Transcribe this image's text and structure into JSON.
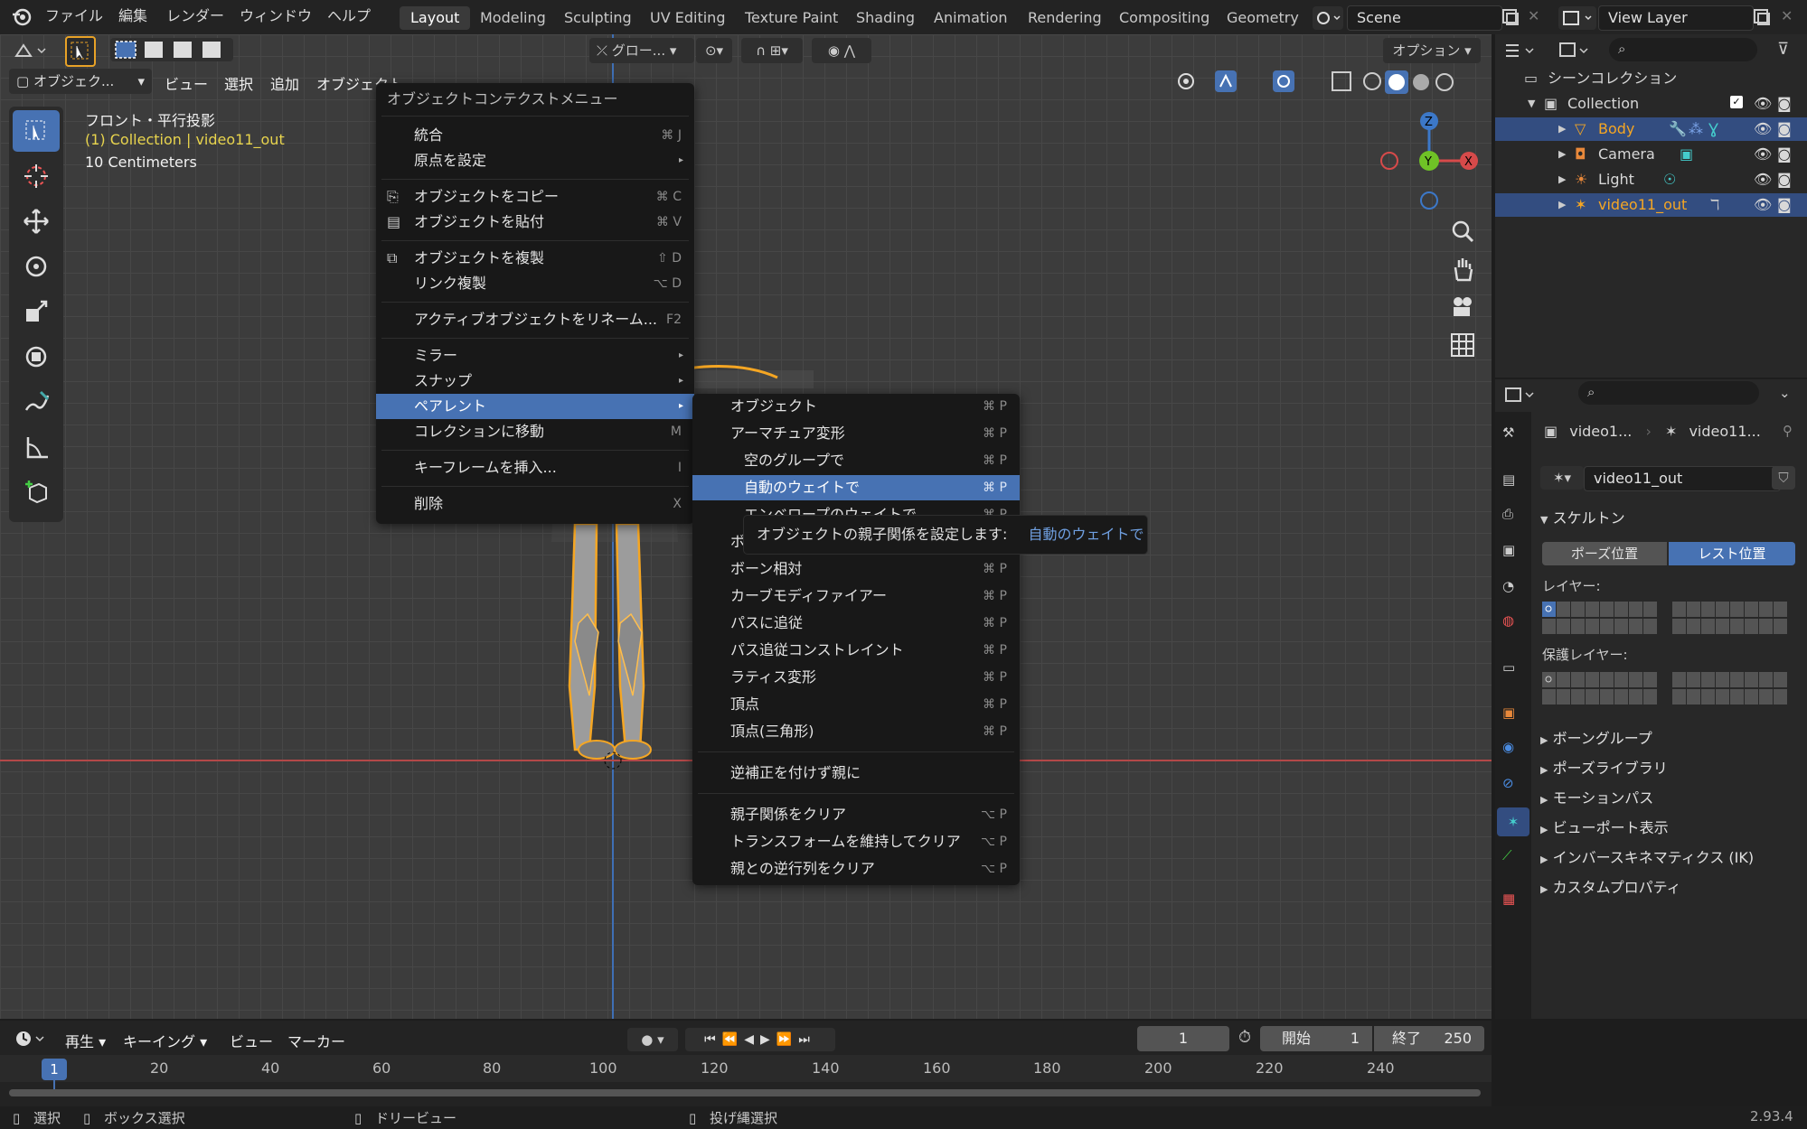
{
  "topbar": {
    "menus": [
      "ファイル",
      "編集",
      "レンダー",
      "ウィンドウ",
      "ヘルプ"
    ],
    "workspaces": [
      "Layout",
      "Modeling",
      "Sculpting",
      "UV Editing",
      "Texture Paint",
      "Shading",
      "Animation",
      "Rendering",
      "Compositing",
      "Geometry"
    ],
    "scene": "Scene",
    "view_layer": "View Layer"
  },
  "viewport": {
    "header": {
      "mode": "オブジェク...",
      "menus": [
        "ビュー",
        "選択",
        "追加",
        "オブジェクト"
      ],
      "transform": "グロー...",
      "options": "オプション"
    },
    "overlay": {
      "view_name": "フロント・平行投影",
      "collection": "(1) Collection | video11_out",
      "scale": "10 Centimeters"
    },
    "gizmo": {
      "z": "Z",
      "y": "Y",
      "x": "X"
    }
  },
  "context_menu": {
    "title": "オブジェクトコンテクストメニュー",
    "items": [
      {
        "label": "統合",
        "shortcut": "⌘ J"
      },
      {
        "label": "原点を設定",
        "shortcut": ""
      },
      {
        "label": "オブジェクトをコピー",
        "shortcut": "⌘ C"
      },
      {
        "label": "オブジェクトを貼付",
        "shortcut": "⌘ V"
      },
      {
        "label": "オブジェクトを複製",
        "shortcut": "⇧ D"
      },
      {
        "label": "リンク複製",
        "shortcut": "⌥ D"
      },
      {
        "label": "アクティブオブジェクトをリネーム...",
        "shortcut": "F2"
      },
      {
        "label": "ミラー",
        "shortcut": ""
      },
      {
        "label": "スナップ",
        "shortcut": ""
      },
      {
        "label": "ペアレント",
        "shortcut": ""
      },
      {
        "label": "コレクションに移動",
        "shortcut": "M"
      },
      {
        "label": "キーフレームを挿入...",
        "shortcut": "I"
      },
      {
        "label": "削除",
        "shortcut": "X"
      }
    ]
  },
  "parent_menu": {
    "items": [
      {
        "label": "オブジェクト",
        "shortcut": "⌘ P"
      },
      {
        "label": "アーマチュア変形",
        "shortcut": "⌘ P"
      },
      {
        "label": "空のグループで",
        "shortcut": "⌘ P"
      },
      {
        "label": "自動のウェイトで",
        "shortcut": "⌘ P"
      },
      {
        "label": "エンベロープのウェイトで",
        "shortcut": "⌘ P"
      },
      {
        "label": "ボーン",
        "shortcut": "⌘ P"
      },
      {
        "label": "ボーン相対",
        "shortcut": "⌘ P"
      },
      {
        "label": "カーブモディファイアー",
        "shortcut": "⌘ P"
      },
      {
        "label": "パスに追従",
        "shortcut": "⌘ P"
      },
      {
        "label": "パス追従コンストレイント",
        "shortcut": "⌘ P"
      },
      {
        "label": "ラティス変形",
        "shortcut": "⌘ P"
      },
      {
        "label": "頂点",
        "shortcut": "⌘ P"
      },
      {
        "label": "頂点(三角形)",
        "shortcut": "⌘ P"
      },
      {
        "label": "逆補正を付けず親に",
        "shortcut": ""
      },
      {
        "label": "親子関係をクリア",
        "shortcut": "⌥ P"
      },
      {
        "label": "トランスフォームを維持してクリア",
        "shortcut": "⌥ P"
      },
      {
        "label": "親との逆行列をクリア",
        "shortcut": "⌥ P"
      }
    ]
  },
  "tooltip": {
    "text": "オブジェクトの親子関係を設定します:",
    "value": "自動のウェイトで"
  },
  "outliner": {
    "scene_collection": "シーンコレクション",
    "collection": "Collection",
    "objects": [
      "Body",
      "Camera",
      "Light",
      "video11_out"
    ]
  },
  "properties": {
    "breadcrumb": [
      "video1...",
      "video11..."
    ],
    "data_name": "video11_out",
    "skeleton": "スケルトン",
    "pose_position": "ポーズ位置",
    "rest_position": "レスト位置",
    "layers": "レイヤー:",
    "protected_layers": "保護レイヤー:",
    "sections": [
      "ボーングループ",
      "ポーズライブラリ",
      "モーションパス",
      "ビューポート表示",
      "インバースキネマティクス (IK)",
      "カスタムプロパティ"
    ]
  },
  "timeline": {
    "menus": [
      "再生",
      "キーイング",
      "ビュー",
      "マーカー"
    ],
    "current_frame": "1",
    "start_label": "開始",
    "start": "1",
    "end_label": "終了",
    "end": "250",
    "frames": [
      "20",
      "40",
      "60",
      "80",
      "100",
      "120",
      "140",
      "160",
      "180",
      "200",
      "220",
      "240"
    ],
    "current_marker": "1"
  },
  "status": {
    "select": "選択",
    "box_select": "ボックス選択",
    "dolly": "ドリービュー",
    "lasso": "投げ縄選択",
    "version": "2.93.4"
  },
  "colors": {
    "accent": "#4772b3",
    "selected_orange": "#f5a623",
    "background": "#3c3c3c"
  }
}
